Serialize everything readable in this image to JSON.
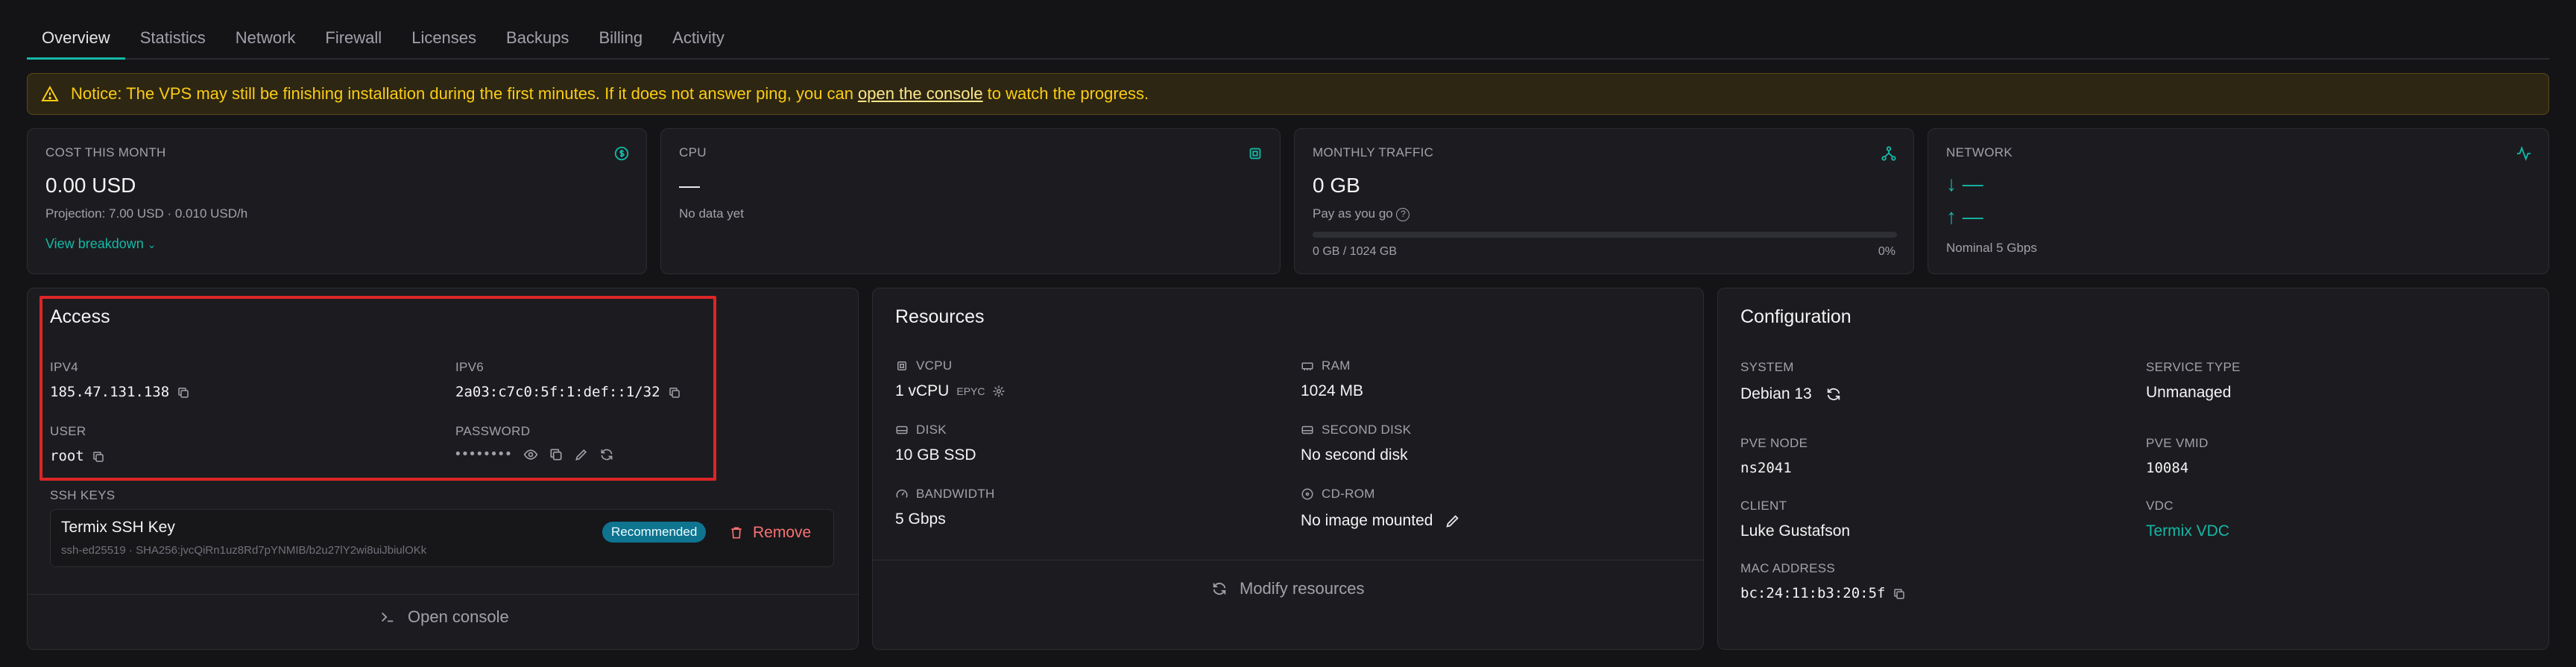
{
  "tabs": [
    "Overview",
    "Statistics",
    "Network",
    "Firewall",
    "Licenses",
    "Backups",
    "Billing",
    "Activity"
  ],
  "notice": {
    "before": "Notice: The VPS may still be finishing installation during the first minutes. If it does not answer ping, you can",
    "link": "open the console",
    "after": "to watch the progress."
  },
  "cost": {
    "label": "COST THIS MONTH",
    "value": "0.00 USD",
    "projection": "Projection: 7.00 USD · 0.010 USD/h",
    "link": "View breakdown"
  },
  "cpu": {
    "label": "CPU",
    "value": "—",
    "sub": "No data yet"
  },
  "traffic": {
    "label": "MONTHLY TRAFFIC",
    "value": "0 GB",
    "sub": "Pay as you go",
    "used": "0 GB",
    "sep": "/",
    "total": "1024 GB",
    "percent": "0%",
    "fill": 0
  },
  "network": {
    "label": "NETWORK",
    "down": "↓ —",
    "up": "↑ —",
    "sub": "Nominal 5 Gbps"
  },
  "access": {
    "title": "Access",
    "ipv4_label": "IPV4",
    "ipv4": "185.47.131.138",
    "ipv6_label": "IPV6",
    "ipv6": "2a03:c7c0:5f:1:def::1/32",
    "user_label": "USER",
    "user": "root",
    "password_label": "PASSWORD",
    "password": "••••••••",
    "ssh_label": "SSH KEYS",
    "key_name": "Termix SSH Key",
    "key_fp": "ssh-ed25519 · SHA256:jvcQiRn1uz8Rd7pYNMIB/b2u27lY2wi8uiJbiulOKk",
    "key_badge": "Recommended",
    "remove": "Remove",
    "console": "Open console"
  },
  "resources": {
    "title": "Resources",
    "vcpu_label": "VCPU",
    "vcpu": "1 vCPU",
    "vcpu_tag": "EPYC",
    "ram_label": "RAM",
    "ram": "1024 MB",
    "disk_label": "DISK",
    "disk": "10 GB SSD",
    "disk2_label": "SECOND DISK",
    "disk2": "No second disk",
    "bw_label": "BANDWIDTH",
    "bw": "5 Gbps",
    "cd_label": "CD-ROM",
    "cd": "No image mounted",
    "modify": "Modify resources"
  },
  "config": {
    "title": "Configuration",
    "system_label": "SYSTEM",
    "system": "Debian 13",
    "service_label": "SERVICE TYPE",
    "service": "Unmanaged",
    "node_label": "PVE NODE",
    "node": "ns2041",
    "vmid_label": "PVE VMID",
    "vmid": "10084",
    "client_label": "CLIENT",
    "client": "Luke Gustafson",
    "vdc_label": "VDC",
    "vdc": "Termix VDC",
    "mac_label": "MAC ADDRESS",
    "mac": "bc:24:11:b3:20:5f"
  },
  "colors": {
    "accent": "#14b8a6",
    "warning": "#facc15",
    "danger": "#f87171",
    "highlight": "#dc2626"
  }
}
